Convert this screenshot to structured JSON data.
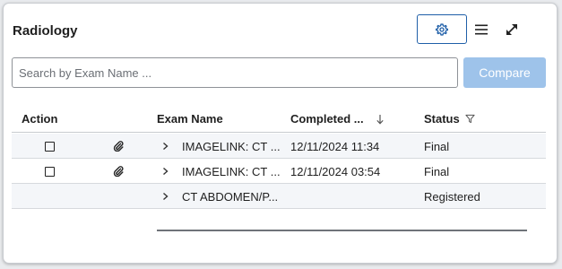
{
  "panel": {
    "title": "Radiology"
  },
  "header": {
    "settings_icon": "settings-gear-icon",
    "menu_icon": "hamburger-menu-icon",
    "expand_icon": "expand-diagonal-icon"
  },
  "search": {
    "placeholder": "Search by Exam Name ...",
    "value": ""
  },
  "compare_button": {
    "label": "Compare"
  },
  "columns": {
    "action": "Action",
    "exam_name": "Exam Name",
    "completed": "Completed ...",
    "status": "Status"
  },
  "rows": [
    {
      "exam_name": "IMAGELINK: CT ...",
      "completed": "12/11/2024 11:34",
      "status": "Final"
    },
    {
      "exam_name": "IMAGELINK: CT ...",
      "completed": "12/11/2024 03:54",
      "status": "Final"
    },
    {
      "exam_name": "CT ABDOMEN/P...",
      "completed": "",
      "status": "Registered"
    }
  ],
  "colors": {
    "accent": "#1f5fa8",
    "compare_disabled": "#9ec3ea",
    "stripe": "#f4f6f9"
  }
}
